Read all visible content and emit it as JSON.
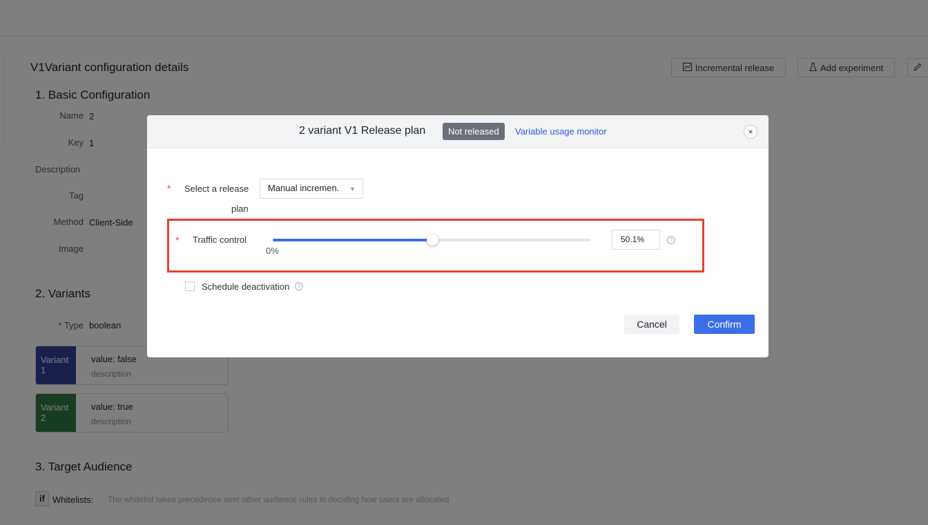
{
  "page": {
    "title": "V1Variant configuration details",
    "header_buttons": {
      "incremental_release": "Incremental release",
      "add_experiment": "Add experiment"
    },
    "basic": {
      "title": "1. Basic Configuration",
      "name_label": "Name",
      "name_value": "2",
      "key_label": "Key",
      "key_value": "1",
      "description_label": "Description",
      "tag_label": "Tag",
      "method_label": "Method",
      "method_value": "Client-Side",
      "image_label": "Image"
    },
    "variants": {
      "title": "2. Variants",
      "type_label": "Type",
      "type_value": "boolean",
      "items": [
        {
          "tag": "Variant 1",
          "value": "value:  false",
          "description": "description",
          "color": "#34409a"
        },
        {
          "tag": "Variant 2",
          "value": "value:  true",
          "description": "description",
          "color": "#2f7a44"
        }
      ]
    },
    "audience": {
      "title": "3. Target Audience",
      "if_badge": "if",
      "whitelist_label": "Whitelists:",
      "whitelist_text": "The whitelist takes precedence over other audience rules in deciding how users are allocated"
    }
  },
  "modal": {
    "title": "2 variant V1 Release plan",
    "status": "Not released",
    "monitor_link": "Variable usage monitor",
    "close_icon": "×",
    "release_label_line1": "Select a release",
    "release_label_line2": "plan",
    "release_value": "Manual incremen.",
    "traffic_label": "Traffic control",
    "traffic_min": "0%",
    "traffic_value": "50.1%",
    "traffic_fraction": 0.501,
    "schedule_label": "Schedule deactivation",
    "cancel": "Cancel",
    "confirm": "Confirm"
  },
  "colors": {
    "accent": "#3b6ee8",
    "highlight": "#e8412e",
    "required": "#f53f3f"
  }
}
